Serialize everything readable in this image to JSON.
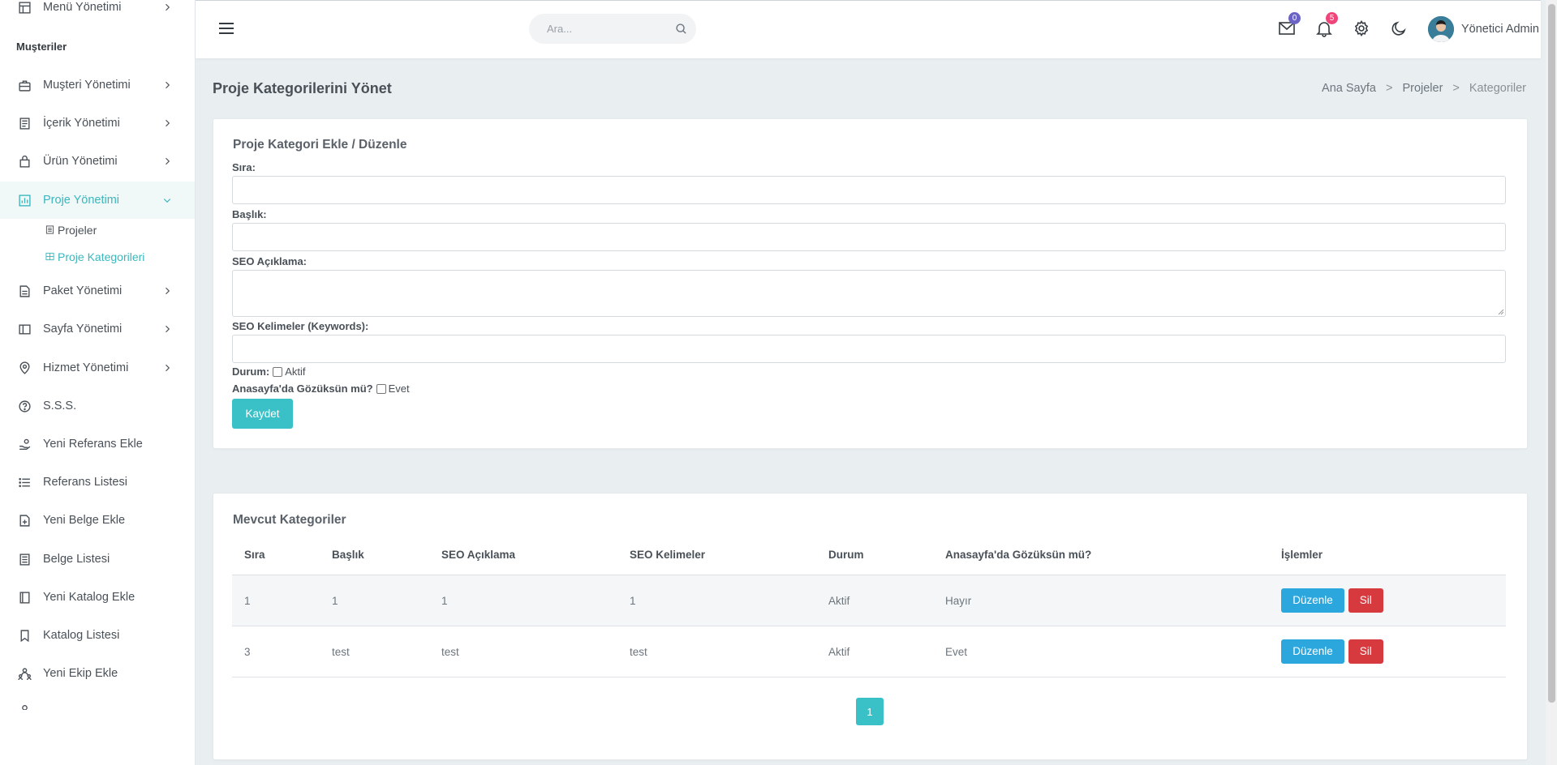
{
  "sidebar": {
    "top_item": "Menü Yönetimi",
    "section_title": "Muşteriler",
    "items": [
      {
        "label": "Muşteri Yönetimi"
      },
      {
        "label": "İçerik Yönetimi"
      },
      {
        "label": "Ürün Yönetimi"
      },
      {
        "label": "Proje Yönetimi"
      },
      {
        "label": "Paket Yönetimi"
      },
      {
        "label": "Sayfa Yönetimi"
      },
      {
        "label": "Hizmet Yönetimi"
      },
      {
        "label": "S.S.S."
      },
      {
        "label": "Yeni Referans Ekle"
      },
      {
        "label": "Referans Listesi"
      },
      {
        "label": "Yeni Belge Ekle"
      },
      {
        "label": "Belge Listesi"
      },
      {
        "label": "Yeni Katalog Ekle"
      },
      {
        "label": "Katalog Listesi"
      },
      {
        "label": "Yeni Ekip Ekle"
      }
    ],
    "sub_items": [
      {
        "label": "Projeler"
      },
      {
        "label": "Proje Kategorileri"
      }
    ]
  },
  "topbar": {
    "search_placeholder": "Ara...",
    "mail_badge": "0",
    "bell_badge": "5",
    "user_name": "Yönetici Admin"
  },
  "header": {
    "title": "Proje Kategorilerini Yönet",
    "breadcrumb": [
      "Ana Sayfa",
      "Projeler",
      "Kategoriler"
    ]
  },
  "form": {
    "title": "Proje Kategori Ekle / Düzenle",
    "fields": {
      "sira": "Sıra:",
      "baslik": "Başlık:",
      "seo_aciklama": "SEO Açıklama:",
      "seo_kelimeler": "SEO Kelimeler (Keywords):"
    },
    "durum_label": "Durum:",
    "durum_option": "Aktif",
    "anasayfa_label": "Anasayfa'da Gözüksün mü?",
    "anasayfa_option": "Evet",
    "save_label": "Kaydet"
  },
  "list": {
    "title": "Mevcut Kategoriler",
    "columns": [
      "Sıra",
      "Başlık",
      "SEO Açıklama",
      "SEO Kelimeler",
      "Durum",
      "Anasayfa'da Gözüksün mü?",
      "İşlemler"
    ],
    "rows": [
      {
        "sira": "1",
        "baslik": "1",
        "seo_aciklama": "1",
        "seo_kelimeler": "1",
        "durum": "Aktif",
        "anasayfa": "Hayır"
      },
      {
        "sira": "3",
        "baslik": "test",
        "seo_aciklama": "test",
        "seo_kelimeler": "test",
        "durum": "Aktif",
        "anasayfa": "Evet"
      }
    ],
    "edit_label": "Düzenle",
    "delete_label": "Sil",
    "page": "1"
  },
  "colors": {
    "accent": "#3ac1c7",
    "edit": "#2ba7de",
    "delete": "#d63a3f"
  }
}
